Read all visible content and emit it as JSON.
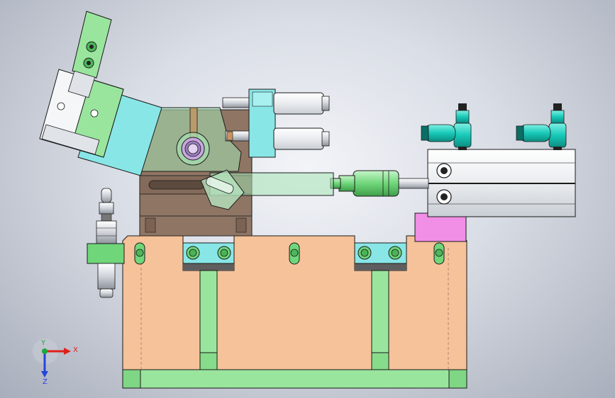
{
  "view": {
    "background_center": "#f2f4f8",
    "background_edge": "#a8aebb"
  },
  "triad": {
    "x_label": "X",
    "y_label": "Y",
    "z_label": "Z",
    "x_color": "#e0201a",
    "y_color": "#1fa83a",
    "z_color": "#2545d8"
  },
  "colors": {
    "base_orange": "#f6c29a",
    "base_dark_orange": "#e2a77d",
    "rail_green": "#9ae59e",
    "clamp_brown": "#8f7564",
    "cylinder_gray": "#e9ecef",
    "fitting_cyan": "#17c9b8",
    "plate_cyan": "#89e6e6",
    "magenta_block": "#f18ee6",
    "outline": "#1a1a1a"
  }
}
